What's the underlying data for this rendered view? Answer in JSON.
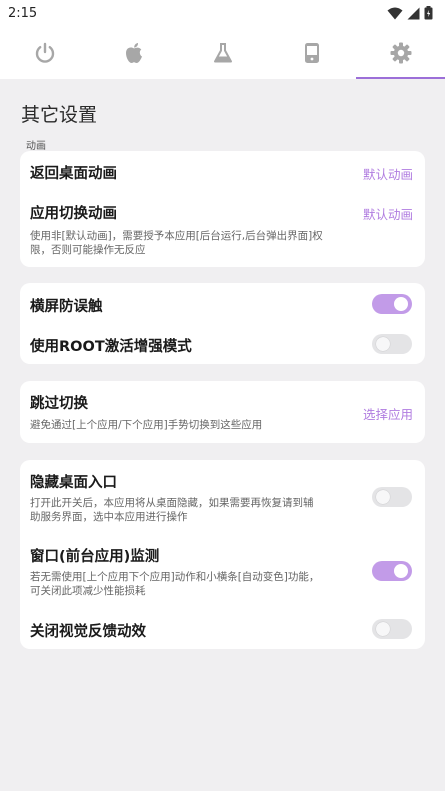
{
  "status_bar": {
    "time": "2:15",
    "icons": [
      "wifi-icon",
      "signal-icon",
      "battery-icon"
    ]
  },
  "tabs": [
    {
      "icon": "power-icon",
      "active": false
    },
    {
      "icon": "apple-icon",
      "active": false
    },
    {
      "icon": "flask-icon",
      "active": false
    },
    {
      "icon": "phone-icon",
      "active": false
    },
    {
      "icon": "gear-icon",
      "active": true
    }
  ],
  "colors": {
    "accent": "#b07ce0",
    "toggle_on": "#c29be8",
    "toggle_off": "#e4e4e6",
    "background": "#f0eff1"
  },
  "page": {
    "title": "其它设置",
    "section_label": "动画"
  },
  "animation_card": {
    "return_home": {
      "title": "返回桌面动画",
      "action": "默认动画"
    },
    "app_switch": {
      "title": "应用切换动画",
      "action": "默认动画",
      "desc_line1": "使用非[默认动画]，需要授予本应用[后台运行,后台弹出界面]权",
      "desc_line2": "限，否则可能操作无反应"
    }
  },
  "mode_card": {
    "landscape": {
      "title": "横屏防误触",
      "enabled": true
    },
    "root_mode": {
      "title": "使用ROOT激活增强模式",
      "enabled": false
    }
  },
  "skip_card": {
    "skip_switch": {
      "title": "跳过切换",
      "desc": "避免通过[上个应用/下个应用]手势切换到这些应用",
      "action": "选择应用"
    }
  },
  "misc_card": {
    "hide_launcher": {
      "title": "隐藏桌面入口",
      "desc_line1": "打开此开关后，本应用将从桌面隐藏，如果需要再恢复请到辅",
      "desc_line2": "助服务界面，选中本应用进行操作",
      "enabled": false
    },
    "window_monitor": {
      "title": "窗口(前台应用)监测",
      "desc_line1": "若无需使用[上个应用下个应用]动作和小横条[自动变色]功能，",
      "desc_line2": "可关闭此项减少性能损耗",
      "enabled": true
    },
    "visual_feedback": {
      "title": "关闭视觉反馈动效",
      "enabled": false
    }
  }
}
